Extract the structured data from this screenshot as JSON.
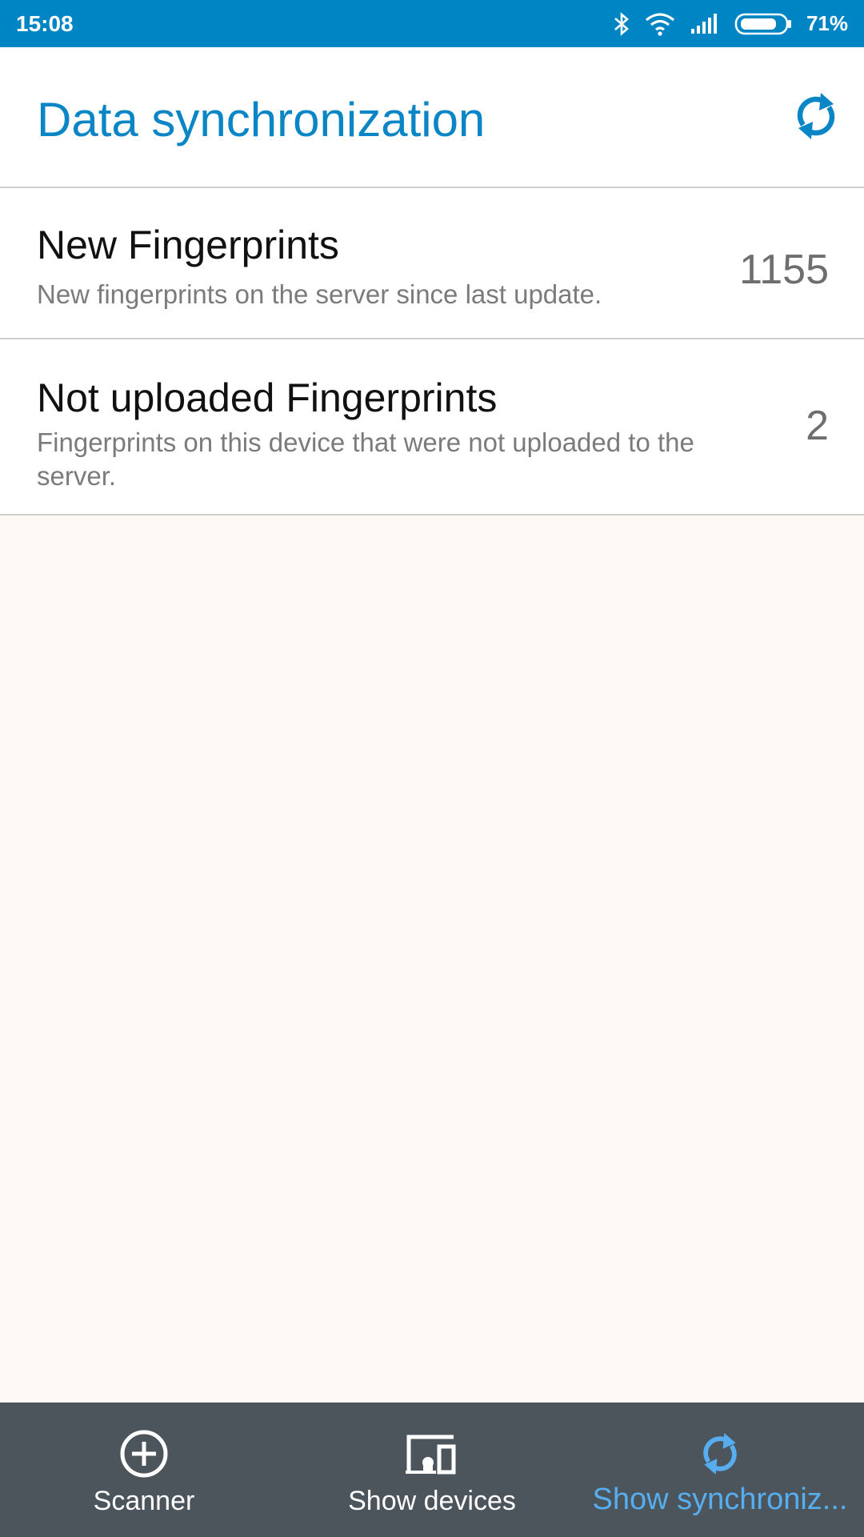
{
  "status_bar": {
    "time": "15:08",
    "battery_percent": "71%",
    "icons": [
      "bluetooth-icon",
      "wifi-icon",
      "signal-icon",
      "battery-icon"
    ]
  },
  "header": {
    "title": "Data synchronization",
    "refresh_icon": "sync-icon"
  },
  "rows": [
    {
      "title": "New Fingerprints",
      "subtitle": "New fingerprints on the server since last update.",
      "count": "1155"
    },
    {
      "title": "Not uploaded Fingerprints",
      "subtitle": "Fingerprints on this device that were not uploaded to the server.",
      "count": "2"
    }
  ],
  "bottom_nav": {
    "items": [
      {
        "label": "Scanner",
        "icon": "add-circle-icon"
      },
      {
        "label": "Show devices",
        "icon": "devices-icon"
      },
      {
        "label": "Show synchroniz...",
        "icon": "sync-icon",
        "active": true
      }
    ]
  },
  "colors": {
    "status_bar": "#0085c4",
    "accent": "#0a86c6",
    "nav_background": "#4b555b",
    "nav_active": "#56aef0",
    "page_background": "#fcf8f4"
  }
}
